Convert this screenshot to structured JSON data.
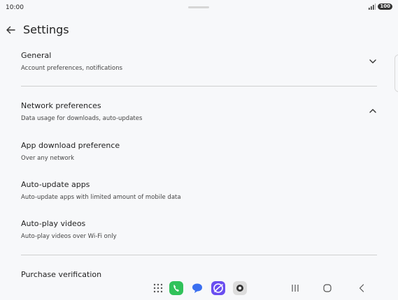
{
  "status_bar": {
    "time": "10:00",
    "battery": "100"
  },
  "header": {
    "title": "Settings"
  },
  "sections": [
    {
      "title": "General",
      "subtitle": "Account preferences, notifications",
      "expanded": false
    },
    {
      "title": "Network preferences",
      "subtitle": "Data usage for downloads, auto-updates",
      "expanded": true
    }
  ],
  "network_items": [
    {
      "title": "App download preference",
      "subtitle": "Over any network"
    },
    {
      "title": "Auto-update apps",
      "subtitle": "Auto-update apps with limited amount of mobile data"
    },
    {
      "title": "Auto-play videos",
      "subtitle": "Auto-play videos over Wi-Fi only"
    }
  ],
  "partial_section": {
    "title": "Purchase verification"
  },
  "dock": {
    "apps": [
      "app-drawer-icon",
      "phone-app-icon",
      "messages-app-icon",
      "internet-app-icon",
      "camera-app-icon"
    ],
    "nav": [
      "recents-icon",
      "home-icon",
      "back-nav-icon"
    ]
  },
  "colors": {
    "background": "#f7f8fa",
    "divider": "#cfcfcf",
    "phone_green": "#31c25a",
    "messages_blue": "#3a6ff0"
  }
}
